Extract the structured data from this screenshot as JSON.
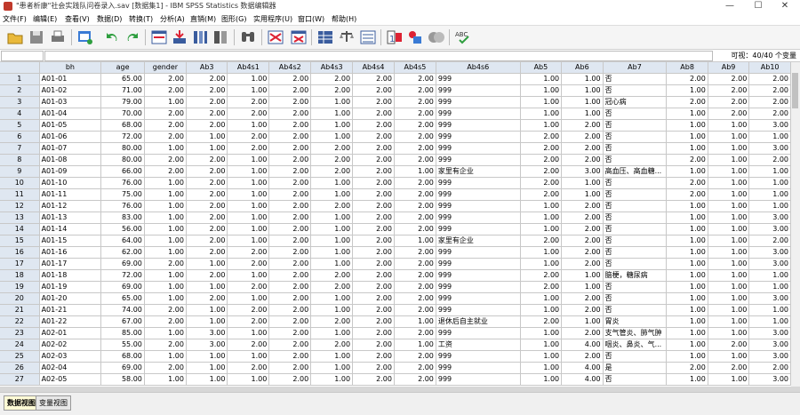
{
  "window": {
    "title": "\"患者析康\"社会实践队问卷录入.sav [数据集1] - IBM SPSS Statistics 数据编辑器",
    "minimize": "—",
    "maximize": "☐",
    "close": "✕"
  },
  "menu": [
    "文件(F)",
    "编辑(E)",
    "查看(V)",
    "数据(D)",
    "转换(T)",
    "分析(A)",
    "直销(M)",
    "图形(G)",
    "实用程序(U)",
    "窗口(W)",
    "帮助(H)"
  ],
  "toolbar_icons": [
    "open-icon",
    "save-icon",
    "print-icon",
    "recall-dialog-icon",
    "undo-icon",
    "redo-icon",
    "goto-case-icon",
    "goto-variable-icon",
    "variables-icon",
    "run-descriptives-icon",
    "find-icon",
    "insert-cases-icon",
    "insert-variable-icon",
    "split-file-icon",
    "weight-cases-icon",
    "select-cases-icon",
    "value-labels-icon",
    "use-sets-icon",
    "show-all-icon",
    "spell-check-icon"
  ],
  "cellbar": {
    "visible_vars": "可视：40/40 个变量"
  },
  "columns": [
    "bh",
    "age",
    "gender",
    "Ab3",
    "Ab4s1",
    "Ab4s2",
    "Ab4s3",
    "Ab4s4",
    "Ab4s5",
    "Ab4s6",
    "Ab5",
    "Ab6",
    "Ab7",
    "Ab8",
    "Ab9",
    "Ab10"
  ],
  "rows": [
    [
      "1",
      "A01-01",
      "65.00",
      "2.00",
      "2.00",
      "1.00",
      "2.00",
      "2.00",
      "2.00",
      "2.00",
      "999",
      "1.00",
      "1.00",
      "否",
      "2.00",
      "2.00",
      "2.00"
    ],
    [
      "2",
      "A01-02",
      "71.00",
      "2.00",
      "2.00",
      "1.00",
      "2.00",
      "2.00",
      "2.00",
      "2.00",
      "999",
      "1.00",
      "1.00",
      "否",
      "1.00",
      "2.00",
      "2.00"
    ],
    [
      "3",
      "A01-03",
      "79.00",
      "1.00",
      "2.00",
      "2.00",
      "2.00",
      "1.00",
      "2.00",
      "2.00",
      "999",
      "1.00",
      "1.00",
      "冠心病",
      "2.00",
      "2.00",
      "2.00"
    ],
    [
      "4",
      "A01-04",
      "70.00",
      "2.00",
      "2.00",
      "2.00",
      "2.00",
      "1.00",
      "2.00",
      "2.00",
      "999",
      "1.00",
      "1.00",
      "否",
      "1.00",
      "2.00",
      "2.00"
    ],
    [
      "5",
      "A01-05",
      "68.00",
      "2.00",
      "2.00",
      "1.00",
      "2.00",
      "1.00",
      "2.00",
      "2.00",
      "999",
      "1.00",
      "2.00",
      "否",
      "1.00",
      "1.00",
      "3.00"
    ],
    [
      "6",
      "A01-06",
      "72.00",
      "2.00",
      "1.00",
      "2.00",
      "2.00",
      "1.00",
      "2.00",
      "2.00",
      "999",
      "2.00",
      "2.00",
      "否",
      "1.00",
      "1.00",
      "1.00"
    ],
    [
      "7",
      "A01-07",
      "80.00",
      "1.00",
      "1.00",
      "2.00",
      "2.00",
      "2.00",
      "2.00",
      "2.00",
      "999",
      "2.00",
      "2.00",
      "否",
      "1.00",
      "1.00",
      "3.00"
    ],
    [
      "8",
      "A01-08",
      "80.00",
      "2.00",
      "2.00",
      "1.00",
      "2.00",
      "2.00",
      "2.00",
      "2.00",
      "999",
      "2.00",
      "2.00",
      "否",
      "2.00",
      "1.00",
      "2.00"
    ],
    [
      "9",
      "A01-09",
      "66.00",
      "2.00",
      "2.00",
      "1.00",
      "2.00",
      "2.00",
      "2.00",
      "1.00",
      "家里有企业",
      "2.00",
      "3.00",
      "高血压、高血糖...",
      "1.00",
      "1.00",
      "1.00"
    ],
    [
      "10",
      "A01-10",
      "76.00",
      "1.00",
      "2.00",
      "1.00",
      "2.00",
      "1.00",
      "2.00",
      "2.00",
      "999",
      "2.00",
      "1.00",
      "否",
      "2.00",
      "1.00",
      "1.00"
    ],
    [
      "11",
      "A01-11",
      "75.00",
      "1.00",
      "2.00",
      "1.00",
      "2.00",
      "1.00",
      "2.00",
      "2.00",
      "999",
      "2.00",
      "1.00",
      "否",
      "2.00",
      "1.00",
      "1.00"
    ],
    [
      "12",
      "A01-12",
      "76.00",
      "1.00",
      "2.00",
      "1.00",
      "2.00",
      "2.00",
      "2.00",
      "2.00",
      "999",
      "1.00",
      "2.00",
      "否",
      "1.00",
      "1.00",
      "1.00"
    ],
    [
      "13",
      "A01-13",
      "83.00",
      "1.00",
      "2.00",
      "1.00",
      "2.00",
      "1.00",
      "2.00",
      "2.00",
      "999",
      "1.00",
      "2.00",
      "否",
      "1.00",
      "1.00",
      "3.00"
    ],
    [
      "14",
      "A01-14",
      "56.00",
      "1.00",
      "2.00",
      "1.00",
      "2.00",
      "1.00",
      "2.00",
      "2.00",
      "999",
      "1.00",
      "2.00",
      "否",
      "1.00",
      "1.00",
      "3.00"
    ],
    [
      "15",
      "A01-15",
      "64.00",
      "1.00",
      "2.00",
      "1.00",
      "2.00",
      "1.00",
      "2.00",
      "1.00",
      "家里有企业",
      "2.00",
      "2.00",
      "否",
      "1.00",
      "1.00",
      "2.00"
    ],
    [
      "16",
      "A01-16",
      "62.00",
      "1.00",
      "2.00",
      "2.00",
      "2.00",
      "1.00",
      "2.00",
      "2.00",
      "999",
      "1.00",
      "2.00",
      "否",
      "1.00",
      "1.00",
      "3.00"
    ],
    [
      "17",
      "A01-17",
      "69.00",
      "2.00",
      "1.00",
      "2.00",
      "2.00",
      "1.00",
      "2.00",
      "2.00",
      "999",
      "1.00",
      "2.00",
      "否",
      "1.00",
      "1.00",
      "3.00"
    ],
    [
      "18",
      "A01-18",
      "72.00",
      "1.00",
      "2.00",
      "1.00",
      "2.00",
      "2.00",
      "2.00",
      "2.00",
      "999",
      "2.00",
      "1.00",
      "脑梗，糖尿病",
      "1.00",
      "1.00",
      "1.00"
    ],
    [
      "19",
      "A01-19",
      "69.00",
      "1.00",
      "1.00",
      "2.00",
      "2.00",
      "2.00",
      "2.00",
      "2.00",
      "999",
      "2.00",
      "1.00",
      "否",
      "1.00",
      "1.00",
      "1.00"
    ],
    [
      "20",
      "A01-20",
      "65.00",
      "1.00",
      "2.00",
      "1.00",
      "2.00",
      "1.00",
      "2.00",
      "2.00",
      "999",
      "1.00",
      "2.00",
      "否",
      "1.00",
      "1.00",
      "3.00"
    ],
    [
      "21",
      "A01-21",
      "74.00",
      "2.00",
      "1.00",
      "2.00",
      "2.00",
      "1.00",
      "2.00",
      "2.00",
      "999",
      "1.00",
      "2.00",
      "否",
      "1.00",
      "1.00",
      "1.00"
    ],
    [
      "22",
      "A01-22",
      "67.00",
      "2.00",
      "1.00",
      "2.00",
      "2.00",
      "2.00",
      "2.00",
      "1.00",
      "退休后自主就业",
      "2.00",
      "1.00",
      "胃炎",
      "1.00",
      "1.00",
      "1.00"
    ],
    [
      "23",
      "A02-01",
      "85.00",
      "1.00",
      "3.00",
      "1.00",
      "2.00",
      "1.00",
      "2.00",
      "2.00",
      "999",
      "1.00",
      "2.00",
      "支气管炎、肺气肿",
      "1.00",
      "1.00",
      "3.00"
    ],
    [
      "24",
      "A02-02",
      "55.00",
      "2.00",
      "3.00",
      "2.00",
      "2.00",
      "2.00",
      "2.00",
      "1.00",
      "工资",
      "1.00",
      "4.00",
      "咽炎、鼻炎、气...",
      "1.00",
      "2.00",
      "3.00"
    ],
    [
      "25",
      "A02-03",
      "68.00",
      "1.00",
      "1.00",
      "1.00",
      "2.00",
      "1.00",
      "2.00",
      "2.00",
      "999",
      "1.00",
      "2.00",
      "否",
      "1.00",
      "1.00",
      "3.00"
    ],
    [
      "26",
      "A02-04",
      "69.00",
      "2.00",
      "1.00",
      "2.00",
      "2.00",
      "1.00",
      "2.00",
      "2.00",
      "999",
      "1.00",
      "4.00",
      "是",
      "2.00",
      "2.00",
      "2.00"
    ],
    [
      "27",
      "A02-05",
      "58.00",
      "1.00",
      "1.00",
      "1.00",
      "2.00",
      "1.00",
      "2.00",
      "2.00",
      "999",
      "1.00",
      "4.00",
      "否",
      "1.00",
      "1.00",
      "3.00"
    ]
  ],
  "tabs": {
    "data_view": "数据视图",
    "variable_view": "变量视图"
  }
}
